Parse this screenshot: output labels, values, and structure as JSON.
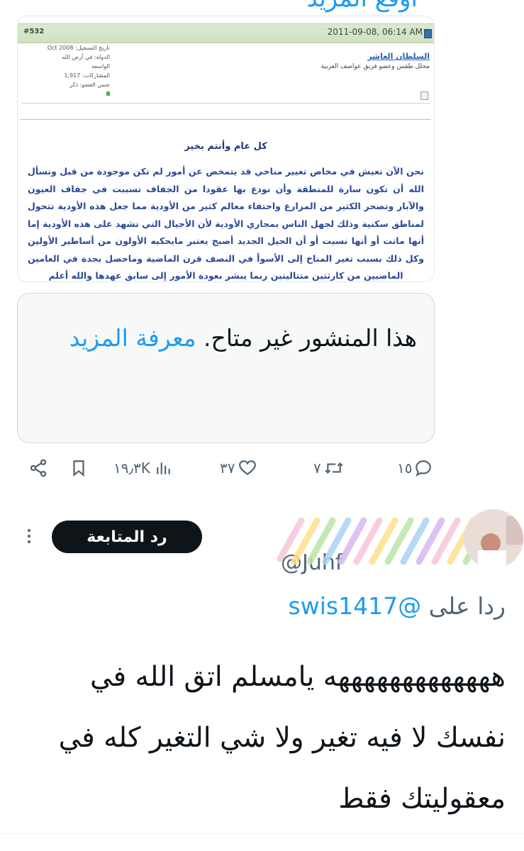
{
  "top_partial_text": "أوقع المزيد",
  "forum_post": {
    "post_number": "#532",
    "date": "2011-09-08, 06:14 AM",
    "username": "السلطان العاشر",
    "user_title": "محلل طقس وعضو فريق عواصف العربية",
    "join_date": "تاريخ التسجيل: Oct 2008",
    "country": "الدولة: في أرض الله الواسعة",
    "posts": "المشاركات: 1,917",
    "gender": "جنس العضو: ذكر",
    "greeting": "كل عام وأنتم بخير",
    "body": "نحن الآن نعيش في مخاض تغيير مناخي قد يتمخض عن أمور لم تكن موجودة من قبل ونسأل الله أن تكون سارة للمنطقة وأن نودع بها عقودا من الجفاف تسببت في جفاف العيون والآبار وتصحر الكثير من المزارع واختفاء معالم كثير من الأودية مما جعل هذه الأودية تتحول لمناطق سكنية وذلك لجهل الناس بمجاري الأودية لأن الأجيال التي تشهد على هذه الأودية إما أنها ماتت أو أنها نسيت أو أن الجيل الجديد أصبح يعتبر مايحكيه الأولون من أساطير الأولين وكل ذلك بسبب تغير المناخ إلى الأسوأ في النصف قرن الماضية وماحصل بجدة في العامين الماضيين من كارثتين متتاليتين ربما يبشر بعودة الأمور إلى سابق عهدها والله أعلم"
  },
  "unavailable": {
    "message": "هذا المنشور غير متاح.",
    "link": "معرفة المزيد"
  },
  "actions": {
    "replies": "١٥",
    "retweets": "٧",
    "likes": "٣٧",
    "views": "١٩٫٣K"
  },
  "reply_tweet": {
    "follow_label": "رد المتابعة",
    "handle_partial": "@Juhf",
    "replying_prefix": "ردا على",
    "replying_to": "@swis1417",
    "text": "هههههههههههههه يامسلم اتق الله في نفسك لا فيه تغير ولا شي التغير كله في معقوليتك فقط"
  },
  "colors": {
    "accent": "#1d9bf0",
    "forum_text": "#2b4a95",
    "muted": "#536471"
  }
}
